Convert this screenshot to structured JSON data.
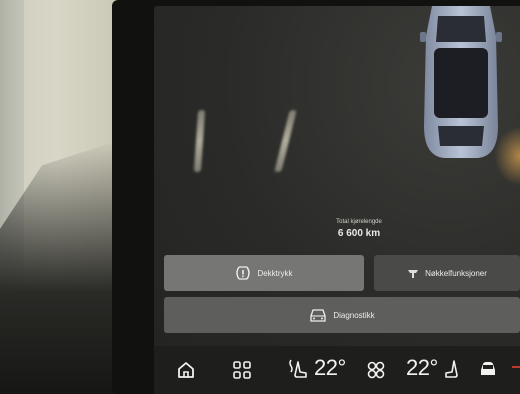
{
  "screen": {
    "odometer": {
      "label": "Total kjørelengde",
      "value": "6 600 km"
    },
    "buttons": {
      "tire_pressure": "Dekktrykk",
      "settings": "Nøkkelfunksjoner",
      "diagnostics": "Diagnostikk"
    },
    "bottom_bar": {
      "driver_temp": "22°",
      "passenger_temp": "22°"
    }
  },
  "colors": {
    "screen_bg": "#2b2b2a",
    "button_active": "#767674",
    "button_inactive": "#4a4a48",
    "accent_red": "#c0392b"
  }
}
